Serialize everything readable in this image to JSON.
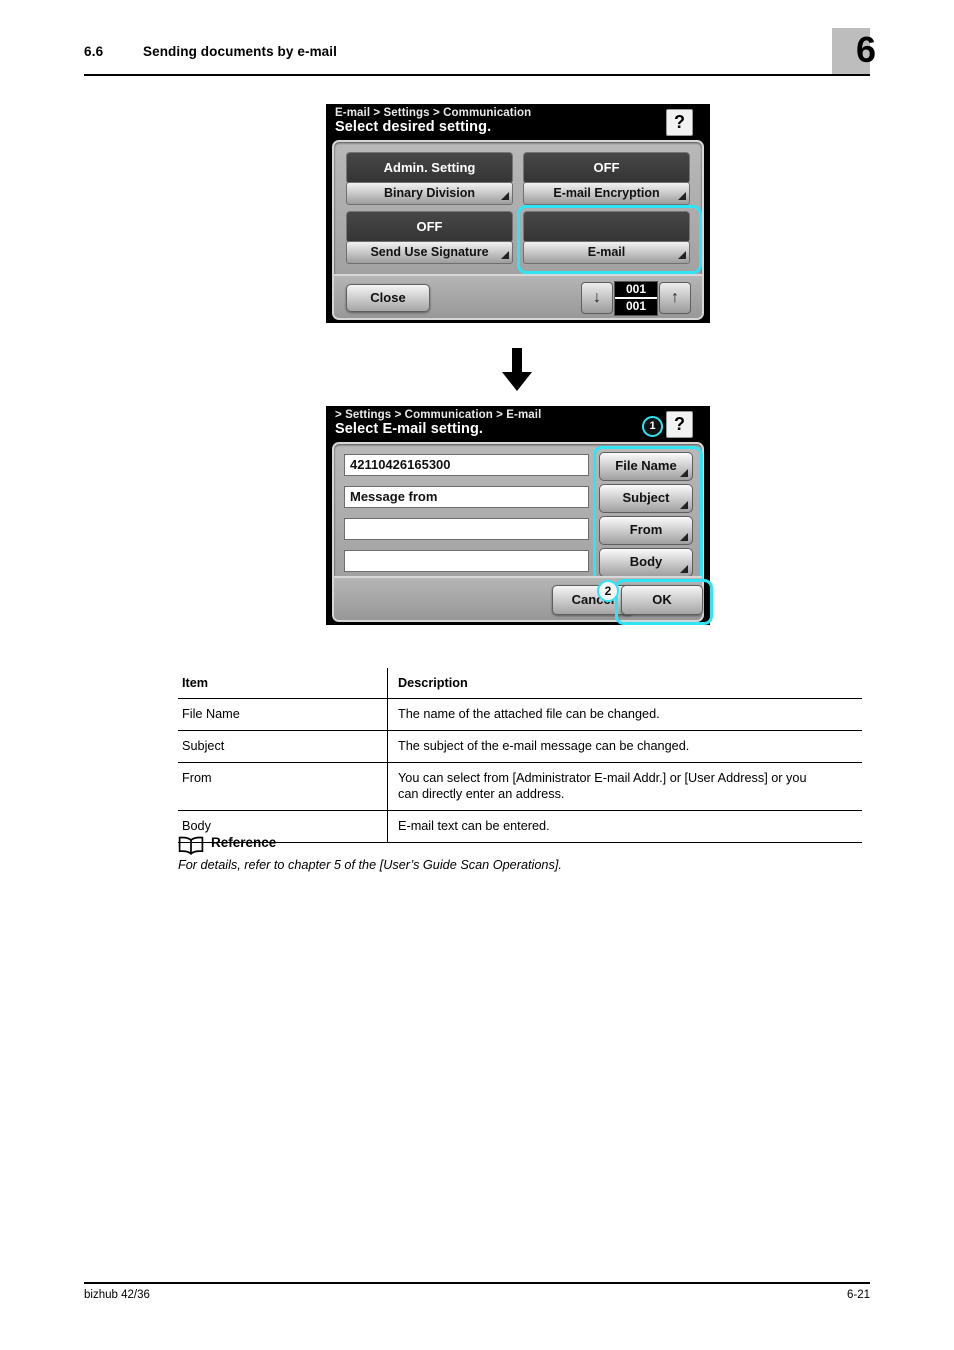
{
  "header": {
    "section_number": "6.6",
    "section_title": "Sending documents by e-mail",
    "chapter_badge": "6"
  },
  "screen_one": {
    "breadcrumb": "E-mail > Settings > Communication",
    "title": "Select desired setting.",
    "help_icon": "?",
    "buttons": [
      {
        "value": "Admin. Setting",
        "label": "Binary Division",
        "highlighted": false
      },
      {
        "value": "OFF",
        "label": "E-mail Encryption",
        "highlighted": false
      },
      {
        "value": "OFF",
        "label": "Send Use Signature",
        "highlighted": false
      },
      {
        "value": "",
        "label": "E-mail",
        "highlighted": true
      }
    ],
    "close_label": "Close",
    "counter_current": "001",
    "counter_total": "001",
    "down_arrow": "↓",
    "up_arrow": "↑"
  },
  "screen_two": {
    "breadcrumb": "> Settings > Communication > E-mail",
    "title": "Select E-mail setting.",
    "help_icon": "?",
    "marker_one": "1",
    "marker_two": "2",
    "fields": [
      {
        "value": "42110426165300"
      },
      {
        "value": "Message from"
      },
      {
        "value": ""
      },
      {
        "value": ""
      }
    ],
    "side_buttons": [
      {
        "label": "File Name"
      },
      {
        "label": "Subject"
      },
      {
        "label": "From"
      },
      {
        "label": "Body"
      }
    ],
    "cancel_label": "Cancel",
    "ok_label": "OK"
  },
  "table": {
    "headers": [
      "Item",
      "Description"
    ],
    "rows": [
      [
        "File Name",
        "The name of the attached file can be changed."
      ],
      [
        "Subject",
        "The subject of the e-mail message can be changed."
      ],
      [
        "From",
        "You can select from [Administrator E-mail Addr.] or [User Address] or you can directly enter an address."
      ],
      [
        "Body",
        "E-mail text can be entered."
      ]
    ]
  },
  "reference": {
    "title": "Reference",
    "text": "For details, refer to chapter 5 of the [User’s Guide Scan Operations]."
  },
  "footer": {
    "left": "bizhub 42/36",
    "right": "6-21"
  },
  "colors": {
    "highlight": "#2ee4f5",
    "badge_gray": "#bdbdbd",
    "lcd_black": "#000000"
  }
}
